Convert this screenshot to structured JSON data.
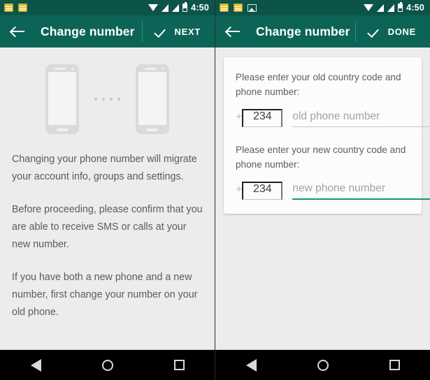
{
  "statusbar": {
    "time": "4:50",
    "icons_left_panel": [
      "note-icon",
      "note-icon"
    ],
    "icons_right_panel": [
      "note-icon",
      "note-icon",
      "image-icon"
    ],
    "icons_right": [
      "wifi-icon",
      "signal-icon",
      "signal-icon",
      "battery-icon"
    ],
    "colors": {
      "background": "#0c5449",
      "foreground": "#ffffff",
      "note": "#e8c33c"
    }
  },
  "left_screen": {
    "toolbar": {
      "back_label": "back-arrow",
      "title": "Change number",
      "action_label": "NEXT",
      "action_icon": "check-icon"
    },
    "illustration": {
      "device_one": "old-phone",
      "device_two": "new-phone",
      "dot_count": 4
    },
    "paragraphs": [
      "Changing your phone number will migrate your account info, groups and settings.",
      "Before proceeding, please confirm that you are able to receive SMS or calls at your new number.",
      "If you have both a new phone and a new number, first change your number on your old phone."
    ]
  },
  "right_screen": {
    "toolbar": {
      "back_label": "back-arrow",
      "title": "Change number",
      "action_label": "DONE",
      "action_icon": "check-icon"
    },
    "form": {
      "old": {
        "label": "Please enter your old country code and phone number:",
        "plus": "+",
        "country_code": "234",
        "phone_placeholder": "old phone number",
        "phone_value": "",
        "focused": false
      },
      "new": {
        "label": "Please enter your new country code and phone number:",
        "plus": "+",
        "country_code": "234",
        "phone_placeholder": "new phone number",
        "phone_value": "",
        "focused": true
      }
    }
  },
  "navbar": {
    "back": "nav-back-icon",
    "home": "nav-home-icon",
    "recents": "nav-recents-icon"
  },
  "colors": {
    "toolbar": "#0b6455",
    "statusbar": "#0c5449",
    "accent": "#15937f",
    "page_background": "#ececec",
    "card_background": "#fcfcfc",
    "body_text": "#5b5b5b"
  }
}
